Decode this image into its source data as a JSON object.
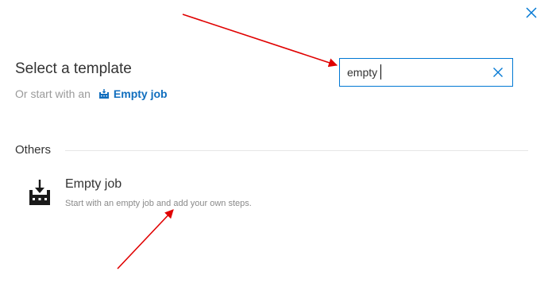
{
  "dialog": {
    "title": "Select a template",
    "subline_prefix": "Or start with an",
    "empty_job_link_label": "Empty job"
  },
  "search": {
    "value": "empty",
    "placeholder": ""
  },
  "section": {
    "header": "Others"
  },
  "templates": [
    {
      "name": "Empty job",
      "description": "Start with an empty job and add your own steps.",
      "icon": "empty-job-icon"
    }
  ],
  "icons": {
    "close": "close-icon",
    "clear_search": "clear-icon",
    "empty_job": "empty-job-icon"
  },
  "colors": {
    "accent": "#0078d4",
    "link": "#106ebe",
    "annotation_arrow": "#e00000"
  }
}
